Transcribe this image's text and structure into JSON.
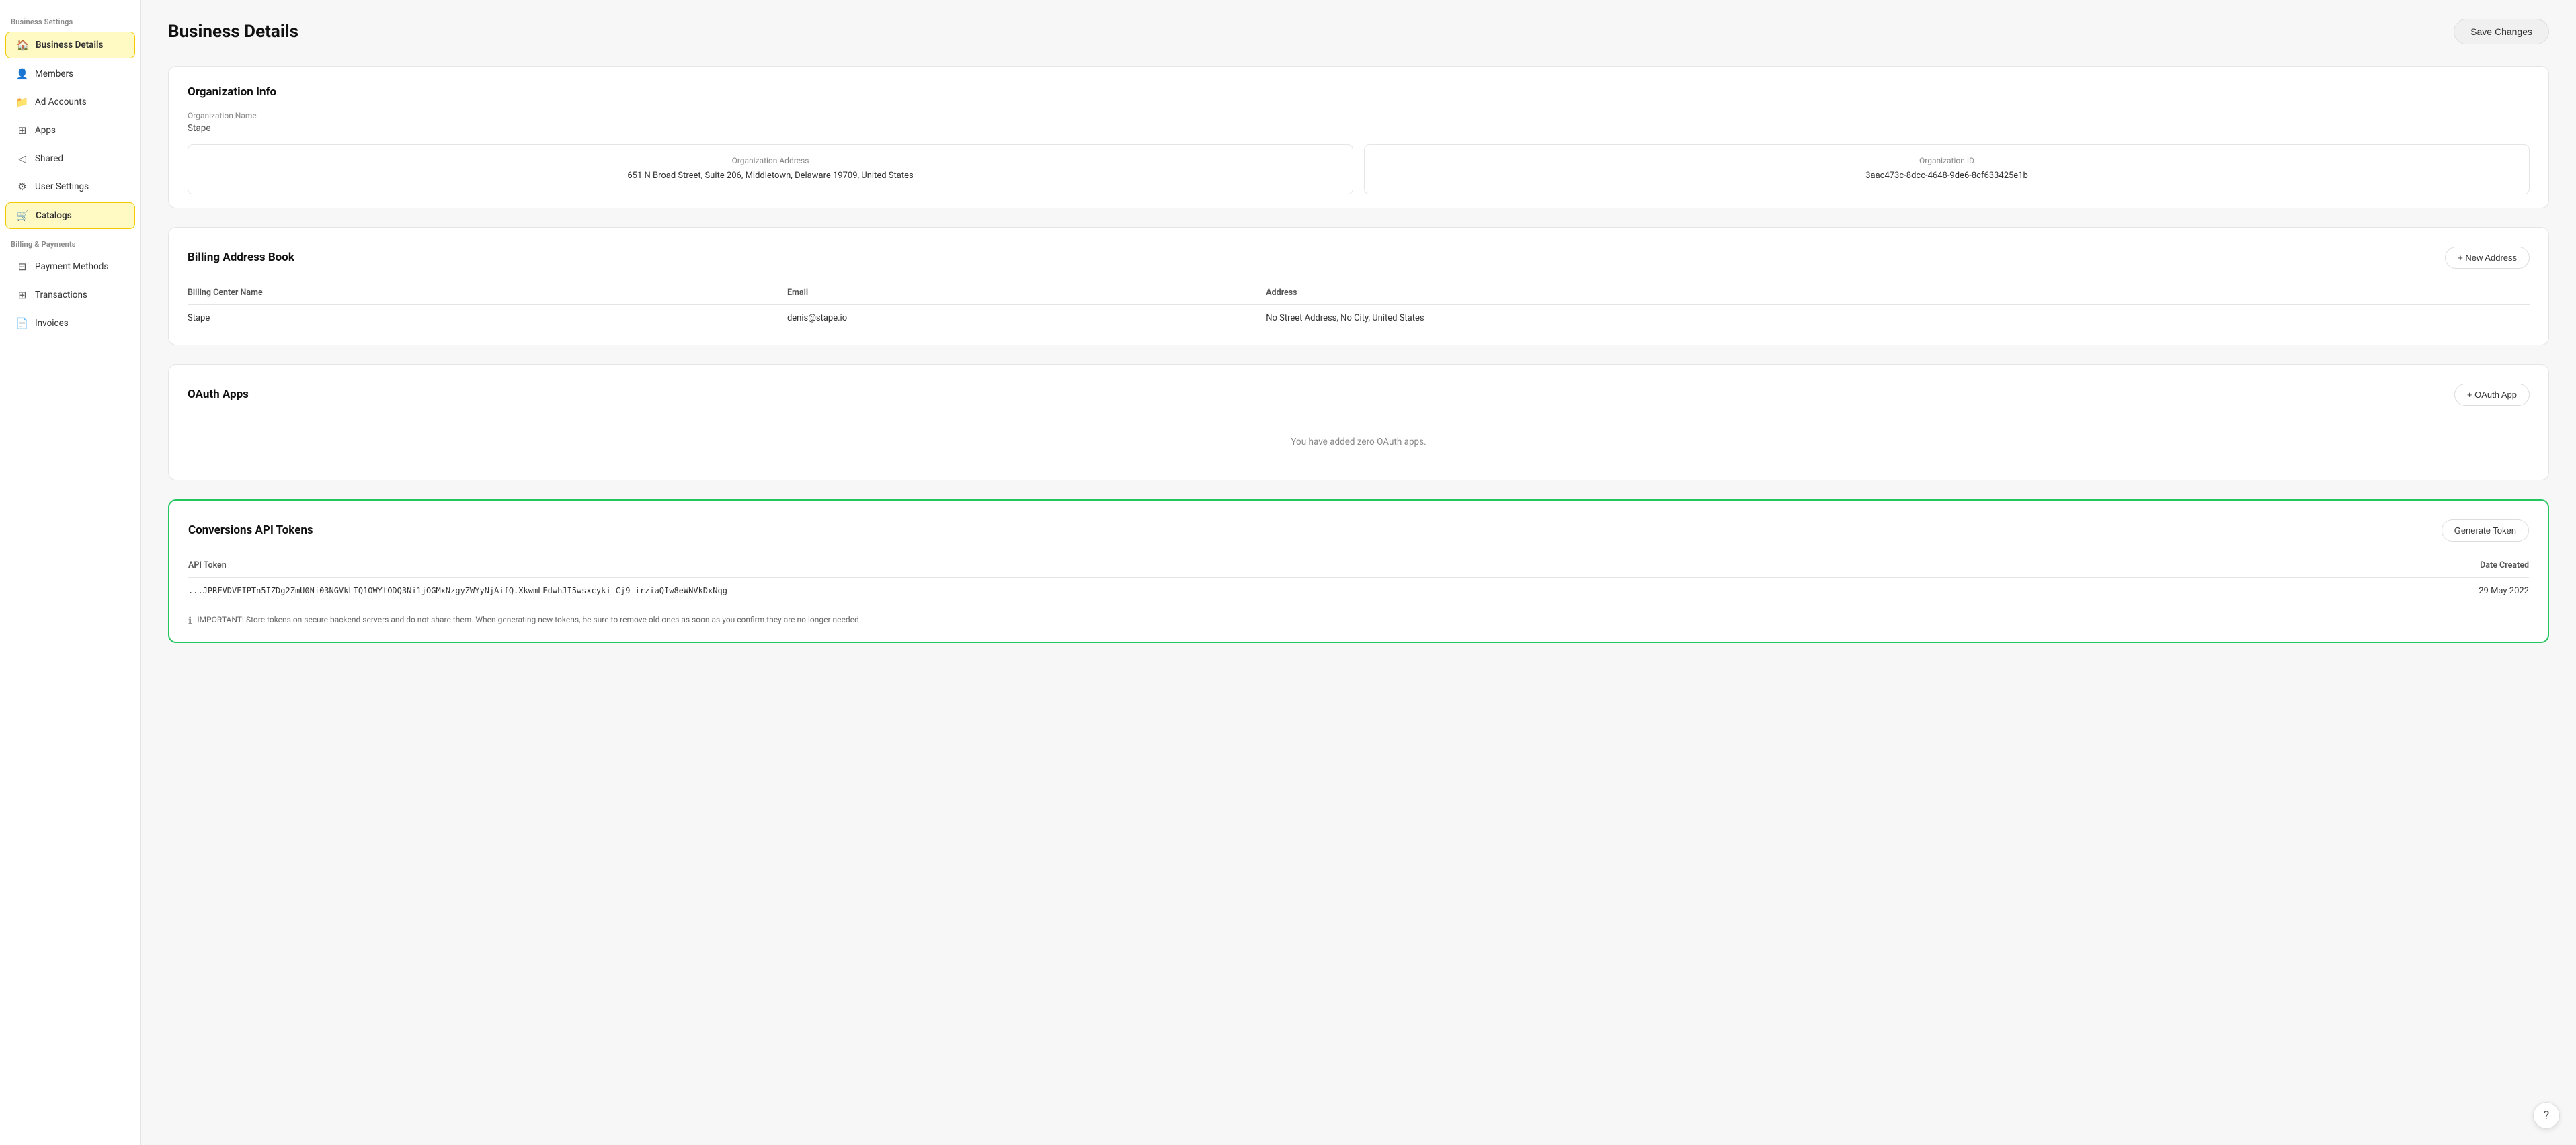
{
  "sidebar": {
    "settings_label": "Business Settings",
    "items": [
      {
        "id": "business-details",
        "label": "Business Details",
        "icon": "🏠",
        "active": true
      },
      {
        "id": "members",
        "label": "Members",
        "icon": "👤",
        "active": false
      },
      {
        "id": "ad-accounts",
        "label": "Ad Accounts",
        "icon": "📁",
        "active": false
      },
      {
        "id": "apps",
        "label": "Apps",
        "icon": "⊞",
        "active": false
      },
      {
        "id": "shared",
        "label": "Shared",
        "icon": "◁",
        "active": false
      },
      {
        "id": "user-settings",
        "label": "User Settings",
        "icon": "⚙",
        "active": false
      },
      {
        "id": "catalogs",
        "label": "Catalogs",
        "icon": "🛒",
        "active": true
      }
    ],
    "billing_label": "Billing & Payments",
    "billing_items": [
      {
        "id": "payment-methods",
        "label": "Payment Methods",
        "icon": "⊟"
      },
      {
        "id": "transactions",
        "label": "Transactions",
        "icon": "⊞"
      },
      {
        "id": "invoices",
        "label": "Invoices",
        "icon": "📄"
      }
    ]
  },
  "header": {
    "title": "Business Details",
    "save_label": "Save Changes"
  },
  "org_info": {
    "section_title": "Organization Info",
    "name_label": "Organization Name",
    "name_value": "Stape",
    "address_label": "Organization Address",
    "address_value": "651 N Broad Street, Suite 206, Middletown, Delaware 19709, United States",
    "id_label": "Organization ID",
    "id_value": "3aac473c-8dcc-4648-9de6-8cf633425e1b"
  },
  "billing_address": {
    "section_title": "Billing Address Book",
    "new_address_label": "+ New Address",
    "columns": [
      "Billing Center Name",
      "Email",
      "Address"
    ],
    "rows": [
      {
        "name": "Stape",
        "email": "denis@stape.io",
        "address": "No Street Address, No City, United States"
      }
    ]
  },
  "oauth_apps": {
    "section_title": "OAuth Apps",
    "btn_label": "+ OAuth App",
    "empty_text": "You have added zero OAuth apps."
  },
  "conversions_api": {
    "section_title": "Conversions API Tokens",
    "generate_label": "Generate Token",
    "columns": [
      "API Token",
      "Date Created"
    ],
    "rows": [
      {
        "token": "...JPRFVDVEIPTn5IZDg2ZmU0Ni03NGVkLTQ1OWYtODQ3Ni1jOGMxNzgyZWYyNjAifQ.XkwmLEdwhJI5wsxcyki_Cj9_irziaQIw8eWNVkDxNqg",
        "date": "29 May 2022"
      }
    ],
    "notice_text": "IMPORTANT! Store tokens on secure backend servers and do not share them. When generating new tokens, be sure to remove old ones as soon as you confirm they are no longer needed."
  }
}
